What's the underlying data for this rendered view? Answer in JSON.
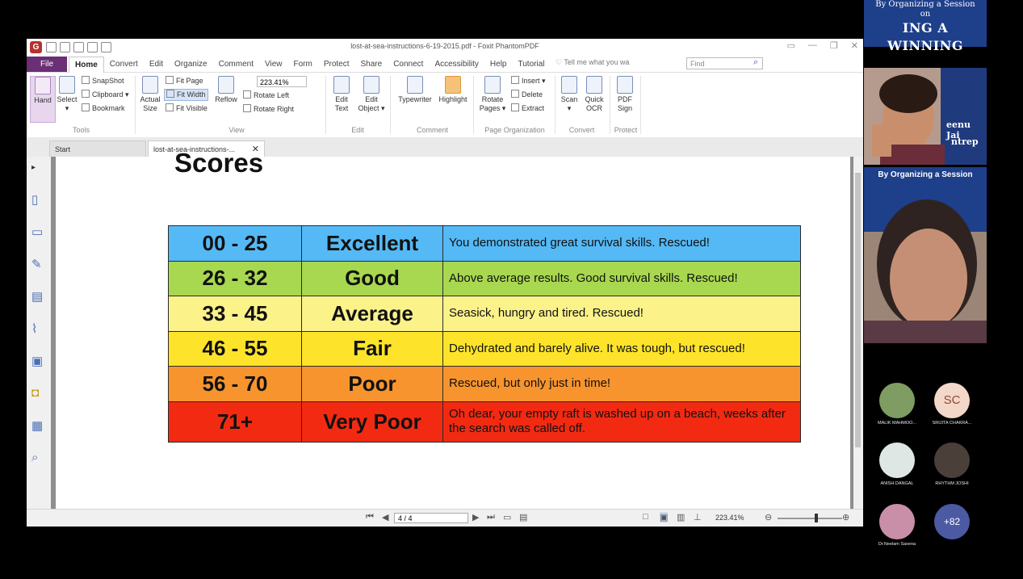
{
  "window": {
    "title": "lost-at-sea-instructions-6-19-2015.pdf - Foxit PhantomPDF"
  },
  "menu": {
    "file": "File",
    "tabs": [
      "Home",
      "Convert",
      "Edit",
      "Organize",
      "Comment",
      "View",
      "Form",
      "Protect",
      "Share",
      "Connect",
      "Accessibility",
      "Help",
      "Tutorial"
    ],
    "tell_me": "Tell me what you wa",
    "find_placeholder": "Find"
  },
  "ribbon": {
    "hand": "Hand",
    "select": "Select",
    "snapshot": "SnapShot",
    "clipboard": "Clipboard",
    "bookmark": "Bookmark",
    "actual_size": [
      "Actual",
      "Size"
    ],
    "fit_page": "Fit Page",
    "fit_width": "Fit Width",
    "fit_visible": "Fit Visible",
    "reflow": "Reflow",
    "zoom": "223.41%",
    "rotate_left": "Rotate Left",
    "rotate_right": "Rotate Right",
    "edit_text": [
      "Edit",
      "Text"
    ],
    "edit_object": [
      "Edit",
      "Object"
    ],
    "typewriter": "Typewriter",
    "highlight": "Highlight",
    "rotate_pages": [
      "Rotate",
      "Pages"
    ],
    "insert": "Insert",
    "delete": "Delete",
    "extract": "Extract",
    "scan": "Scan",
    "quick_ocr": [
      "Quick",
      "OCR"
    ],
    "pdf_sign": [
      "PDF",
      "Sign"
    ],
    "groups": [
      "Tools",
      "View",
      "Edit",
      "Comment",
      "Page Organization",
      "Convert",
      "Protect"
    ]
  },
  "tabs": {
    "start": "Start",
    "doc": "lost-at-sea-instructions-..."
  },
  "page": {
    "heading": "Scores",
    "rows": [
      {
        "range": "00 - 25",
        "rating": "Excellent",
        "desc": "You demonstrated great survival skills. Rescued!",
        "color": "#55b9f5"
      },
      {
        "range": "26 - 32",
        "rating": "Good",
        "desc": "Above average results. Good survival skills. Rescued!",
        "color": "#a8d84f"
      },
      {
        "range": "33 - 45",
        "rating": "Average",
        "desc": "Seasick, hungry and tired. Rescued!",
        "color": "#fbf28a"
      },
      {
        "range": "46 - 55",
        "rating": "Fair",
        "desc": "Dehydrated and barely alive. It was tough, but rescued!",
        "color": "#fde42a"
      },
      {
        "range": "56 - 70",
        "rating": "Poor",
        "desc": "Rescued, but only just in time!",
        "color": "#f7942e"
      },
      {
        "range": "71+",
        "rating": "Very Poor",
        "desc": "Oh dear, your empty raft is washed up on a beach, weeks after the search was called off.",
        "color": "#f22a12"
      }
    ]
  },
  "status": {
    "page": "4 / 4",
    "zoom": "223.41%"
  },
  "meeting": {
    "banner_line1": "By Organizing a Session",
    "banner_line2": "on",
    "banner_line3": "ING A WINNING",
    "session_banner": "By Organizing a Session",
    "name_fragment_1": "eenu Jai",
    "name_fragment_2": "ntrep",
    "participants": [
      {
        "name": "MALIK MAHMOO...",
        "initials": ""
      },
      {
        "name": "SRIJITA CHAKRA...",
        "initials": "SC"
      },
      {
        "name": "ANISH DANGAL",
        "initials": ""
      },
      {
        "name": "RHYTHM JOSHI",
        "initials": ""
      },
      {
        "name": "Dr.Neelam Saxena",
        "initials": ""
      }
    ],
    "more": "+82"
  }
}
